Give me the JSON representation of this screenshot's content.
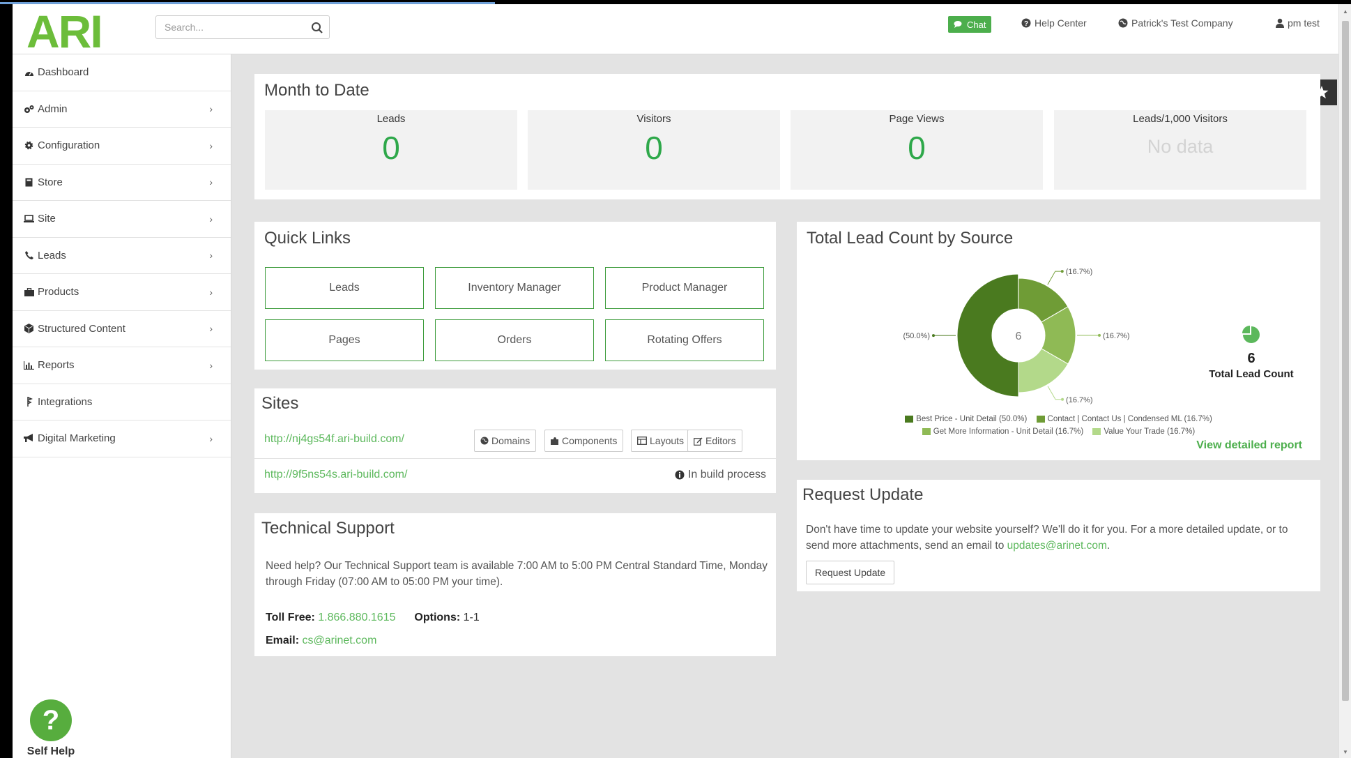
{
  "header": {
    "logo_text": "ARI",
    "search_placeholder": "Search...",
    "chat_label": "Chat",
    "help_label": "Help Center",
    "company_label": "Patrick's Test Company",
    "user_label": "pm test"
  },
  "sidebar": {
    "items": [
      {
        "label": "Dashboard",
        "icon": "dashboard-icon",
        "chevron": false
      },
      {
        "label": "Admin",
        "icon": "cogs-icon",
        "chevron": true
      },
      {
        "label": "Configuration",
        "icon": "gear-icon",
        "chevron": true
      },
      {
        "label": "Store",
        "icon": "book-icon",
        "chevron": true
      },
      {
        "label": "Site",
        "icon": "laptop-icon",
        "chevron": true
      },
      {
        "label": "Leads",
        "icon": "phone-icon",
        "chevron": true
      },
      {
        "label": "Products",
        "icon": "briefcase-icon",
        "chevron": true
      },
      {
        "label": "Structured Content",
        "icon": "cube-icon",
        "chevron": true
      },
      {
        "label": "Reports",
        "icon": "bar-chart-icon",
        "chevron": true
      },
      {
        "label": "Integrations",
        "icon": "plug-icon",
        "chevron": false
      },
      {
        "label": "Digital Marketing",
        "icon": "bullhorn-icon",
        "chevron": true
      }
    ],
    "self_help_mark": "?",
    "self_help_label": "Self Help"
  },
  "mtd": {
    "title": "Month to Date",
    "stats": [
      {
        "label": "Leads",
        "value": "0"
      },
      {
        "label": "Visitors",
        "value": "0"
      },
      {
        "label": "Page Views",
        "value": "0"
      },
      {
        "label": "Leads/1,000 Visitors",
        "value": "No data"
      }
    ]
  },
  "quick_links": {
    "title": "Quick Links",
    "buttons": [
      "Leads",
      "Inventory Manager",
      "Product Manager",
      "Pages",
      "Orders",
      "Rotating Offers"
    ]
  },
  "sites": {
    "title": "Sites",
    "rows": [
      {
        "url": "http://nj4gs54f.ari-build.com/"
      },
      {
        "url": "http://9f5ns54s.ari-build.com/",
        "status": "In build process"
      }
    ],
    "buttons": [
      "Domains",
      "Components",
      "Layouts",
      "Editors"
    ]
  },
  "tech_support": {
    "title": "Technical Support",
    "description": "Need help? Our Technical Support team is available 7:00 AM to 5:00 PM Central Standard Time, Monday through Friday (07:00 AM to 05:00 PM your time).",
    "toll_free_label": "Toll Free:",
    "toll_free_value": "1.866.880.1615",
    "options_label": "Options:",
    "options_value": "1-1",
    "email_label": "Email:",
    "email_value": "cs@arinet.com"
  },
  "chart_panel": {
    "title": "Total Lead Count by Source",
    "center_label": "6",
    "total_value": "6",
    "total_caption": "Total Lead Count",
    "view_report": "View detailed report"
  },
  "chart_data": {
    "type": "pie",
    "title": "Total Lead Count by Source",
    "categories": [
      "Best Price - Unit Detail",
      "Contact | Contact Us | Condensed ML",
      "Get More Information - Unit Detail",
      "Value Your Trade"
    ],
    "values": [
      50.0,
      16.7,
      16.7,
      16.7
    ],
    "slice_labels": [
      "(50.0%)",
      "(16.7%)",
      "(16.7%)",
      "(16.7%)"
    ],
    "legend": [
      "Best Price - Unit Detail (50.0%)",
      "Contact | Contact Us | Condensed ML (16.7%)",
      "Get More Information - Unit Detail (16.7%)",
      "Value Your Trade (16.7%)"
    ],
    "colors": [
      "#4a7a1f",
      "#6f9c36",
      "#8fba55",
      "#b3d98a"
    ]
  },
  "request_update": {
    "title": "Request Update",
    "description_pre": "Don't have time to update your website yourself? We'll do it for you. For a more detailed update, or to send more attachments, send an email to ",
    "email": "updates@arinet.com",
    "description_post": ".",
    "button": "Request Update"
  },
  "colors": {
    "brand_green": "#5cb85c",
    "accent_green": "#2ea84a",
    "page_bg": "#e3e3e3"
  }
}
